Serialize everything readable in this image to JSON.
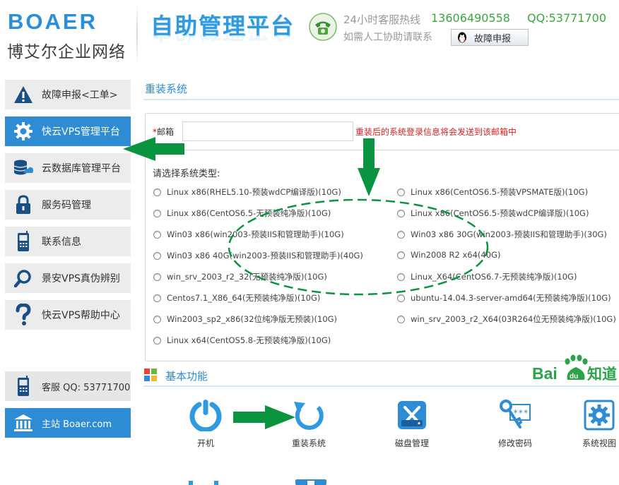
{
  "brand": {
    "name_en": "BOAER",
    "name_cn": "博艾尔企业网络"
  },
  "header": {
    "title": "自助管理平台",
    "hotline_label": "24小时客服热线",
    "hotline_number": "13606490558",
    "qq": "QQ:53771700",
    "assist_text": "如需人工协助请联系",
    "report_button": "故障申报"
  },
  "sidebar": {
    "items": [
      {
        "label": "故障申报<工单>",
        "icon": "warning-icon"
      },
      {
        "label": "快云VPS管理平台",
        "icon": "gear-icon"
      },
      {
        "label": "云数据库管理平台",
        "icon": "database-icon"
      },
      {
        "label": "服务码管理",
        "icon": "lock-icon"
      },
      {
        "label": "联系信息",
        "icon": "phone-icon"
      },
      {
        "label": "景安VPS真伪辨别",
        "icon": "search-icon"
      },
      {
        "label": "快云VPS帮助中心",
        "icon": "help-icon"
      }
    ],
    "service_label": "客服 QQ: 53771700",
    "main_site_label": "主站 Boaer.com"
  },
  "reinstall": {
    "section_title": "重装系统",
    "email_label": "邮箱",
    "email_value": "",
    "email_hint": "重装后的系统登录信息将会发送到该邮箱中",
    "os_prompt": "请选择系统类型:",
    "left_options": [
      "Linux x86(RHEL5.10-预装wdCP编译版)(10G)",
      "Linux x86(CentOS6.5-无预装纯净版)(10G)",
      "Win03 x86(win2003-预装IIS和管理助手)(10G)",
      "Win03 x86 40G(win2003-预装IIS和管理助手)(40G)",
      "win_srv_2003_r2_32(无预装纯净版)(10G)",
      "Centos7.1_X86_64(无预装纯净版)(10G)",
      "Win2003_sp2_x86(32位纯净版无预装)(10G)",
      "Linux x64(CentOS5.8-无预装纯净版)(10G)"
    ],
    "right_options": [
      "Linux x86(CentOS6.5-预装VPSMATE版)(10G)",
      "Linux x86(CentOS6.5-预装wdCP编译版)(10G)",
      "Win03 x86 30G(win2003-预装IIS和管理助手)(30G)",
      "Win2008 R2 x64(40G)",
      "Linux_X64(CentOS6.7-无预装纯净版)(10G)",
      "ubuntu-14.04.3-server-amd64(无预装纯净版)(10G)",
      "win_srv_2003_r2_X64(03R264位无预装纯净版)(10G)"
    ]
  },
  "basic": {
    "section_title": "基本功能",
    "baidu_text": "Bai知道",
    "functions": [
      {
        "label": "开机",
        "icon": "power-icon"
      },
      {
        "label": "重装系统",
        "icon": "reinstall-icon"
      },
      {
        "label": "磁盘管理",
        "icon": "disk-tools-icon"
      },
      {
        "label": "修改密码",
        "icon": "key-icon"
      },
      {
        "label": "系统视图",
        "icon": "settings-icon"
      }
    ]
  },
  "colors": {
    "brand_blue": "#2e8cd4",
    "highlight_green": "#0b9440",
    "hint_red": "#d42222"
  }
}
